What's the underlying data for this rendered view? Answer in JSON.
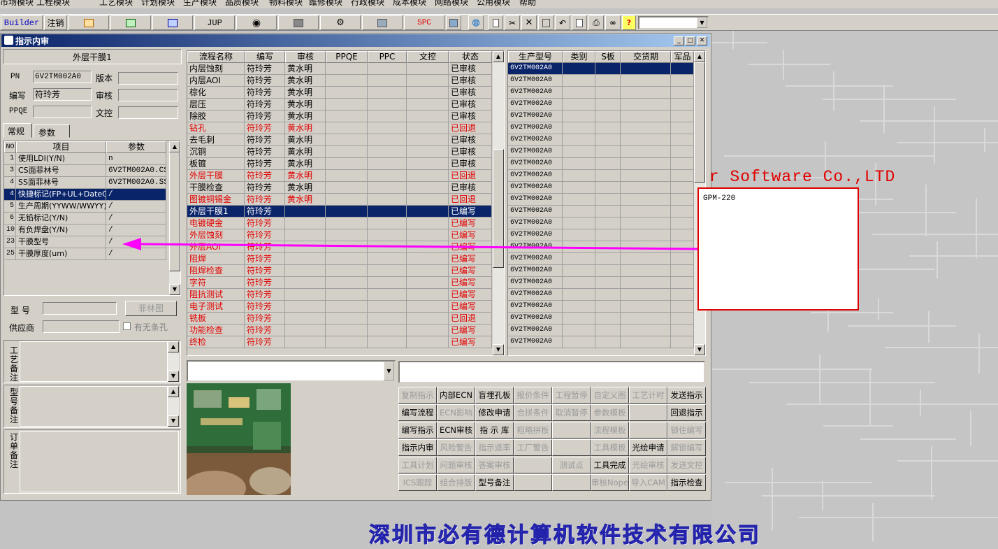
{
  "menu": [
    "市场模块",
    "工程模块",
    "工艺模块",
    "计划模块",
    "生产模块",
    "品质模块",
    "物料模块",
    "维修模块",
    "行政模块",
    "成本模块",
    "网络模块",
    "公用模块",
    "帮助"
  ],
  "toolbar": {
    "builder": "Builder",
    "logout": "注销",
    "jup": "JUP",
    "spc": "SPC",
    "help": "?"
  },
  "window": {
    "title": "指示内审"
  },
  "left": {
    "title": "外层干膜1",
    "pn_label": "PN",
    "pn_value": "6V2TM002A0",
    "version_label": "版本",
    "version_value": "",
    "editor_label": "编写",
    "editor_value": "符玲芳",
    "review_label": "审核",
    "review_value": "",
    "ppqe_label": "PPQE",
    "ppqe_value": "",
    "doc_label": "文控",
    "doc_value": "",
    "tabs": [
      "常规",
      "参数"
    ],
    "param_headers": [
      "NO",
      "项目",
      "参数"
    ],
    "params": [
      {
        "no": "1",
        "item": "使用LDI(Y/N)",
        "value": "n",
        "sel": false
      },
      {
        "no": "3",
        "item": "CS面菲林号",
        "value": "6V2TM002A0.CS2",
        "sel": false
      },
      {
        "no": "4",
        "item": "SS面菲林号",
        "value": "6V2TM002A0.SS2",
        "sel": false
      },
      {
        "no": "4",
        "item": "快捷标记(FP+UL+DateC",
        "value": "/",
        "sel": true
      },
      {
        "no": "5",
        "item": "生产周期(YYWW/WWYY)",
        "value": "/",
        "sel": false
      },
      {
        "no": "6",
        "item": "无铅标记(Y/N)",
        "value": "/",
        "sel": false
      },
      {
        "no": "10",
        "item": "有负焊盘(Y/N)",
        "value": "/",
        "sel": false
      },
      {
        "no": "23",
        "item": "干膜型号",
        "value": "/",
        "sel": false
      },
      {
        "no": "25",
        "item": "干膜厚度(um)",
        "value": "/",
        "sel": false
      }
    ],
    "model_label": "型  号",
    "model_value": "",
    "film_button": "菲林图",
    "supplier_label": "供应商",
    "supplier_value": "",
    "strip_label": "有无条孔",
    "memo_labels": [
      "工艺备注",
      "型号备注",
      "订单备注"
    ]
  },
  "process": {
    "headers": [
      "流程名称",
      "编写",
      "审核",
      "PPQE",
      "PPC",
      "文控",
      "状态"
    ],
    "rows": [
      {
        "name": "内层蚀刻",
        "w": "符玲芳",
        "r": "黄水明",
        "s": "已审核",
        "red": false,
        "sel": false
      },
      {
        "name": "内层AOI",
        "w": "符玲芳",
        "r": "黄水明",
        "s": "已审核",
        "red": false,
        "sel": false
      },
      {
        "name": "棕化",
        "w": "符玲芳",
        "r": "黄水明",
        "s": "已审核",
        "red": false,
        "sel": false
      },
      {
        "name": "层压",
        "w": "符玲芳",
        "r": "黄水明",
        "s": "已审核",
        "red": false,
        "sel": false
      },
      {
        "name": "除胶",
        "w": "符玲芳",
        "r": "黄水明",
        "s": "已审核",
        "red": false,
        "sel": false
      },
      {
        "name": "钻孔",
        "w": "符玲芳",
        "r": "黄水明",
        "s": "已回退",
        "red": true,
        "sel": false
      },
      {
        "name": "去毛刺",
        "w": "符玲芳",
        "r": "黄水明",
        "s": "已审核",
        "red": false,
        "sel": false
      },
      {
        "name": "沉铜",
        "w": "符玲芳",
        "r": "黄水明",
        "s": "已审核",
        "red": false,
        "sel": false
      },
      {
        "name": "板镀",
        "w": "符玲芳",
        "r": "黄水明",
        "s": "已审核",
        "red": false,
        "sel": false
      },
      {
        "name": "外层干膜",
        "w": "符玲芳",
        "r": "黄水明",
        "s": "已回退",
        "red": true,
        "sel": false
      },
      {
        "name": "干膜检查",
        "w": "符玲芳",
        "r": "黄水明",
        "s": "已审核",
        "red": false,
        "sel": false
      },
      {
        "name": "图镀铜锡金",
        "w": "符玲芳",
        "r": "黄水明",
        "s": "已回退",
        "red": true,
        "sel": false
      },
      {
        "name": "外层干膜1",
        "w": "符玲芳",
        "r": "",
        "s": "已编写",
        "red": true,
        "sel": true
      },
      {
        "name": "电镀硬金",
        "w": "符玲芳",
        "r": "",
        "s": "已编写",
        "red": true,
        "sel": false
      },
      {
        "name": "外层蚀刻",
        "w": "符玲芳",
        "r": "",
        "s": "已编写",
        "red": true,
        "sel": false
      },
      {
        "name": "外层AOI",
        "w": "符玲芳",
        "r": "",
        "s": "已编写",
        "red": true,
        "sel": false
      },
      {
        "name": "阻焊",
        "w": "符玲芳",
        "r": "",
        "s": "已编写",
        "red": true,
        "sel": false
      },
      {
        "name": "阻焊检查",
        "w": "符玲芳",
        "r": "",
        "s": "已编写",
        "red": true,
        "sel": false
      },
      {
        "name": "字符",
        "w": "符玲芳",
        "r": "",
        "s": "已编写",
        "red": true,
        "sel": false
      },
      {
        "name": "阻抗测试",
        "w": "符玲芳",
        "r": "",
        "s": "已编写",
        "red": true,
        "sel": false
      },
      {
        "name": "电子测试",
        "w": "符玲芳",
        "r": "",
        "s": "已编写",
        "red": true,
        "sel": false
      },
      {
        "name": "铣板",
        "w": "符玲芳",
        "r": "",
        "s": "已回退",
        "red": true,
        "sel": false
      },
      {
        "name": "功能检查",
        "w": "符玲芳",
        "r": "",
        "s": "已编写",
        "red": true,
        "sel": false
      },
      {
        "name": "终检",
        "w": "符玲芳",
        "r": "",
        "s": "已编写",
        "red": true,
        "sel": false
      }
    ]
  },
  "models": {
    "headers": [
      "生产型号",
      "类别",
      "S板",
      "交货期",
      "军品"
    ],
    "rows": [
      "6V2TM002A0",
      "6V2TM002A0",
      "6V2TM002A0",
      "6V2TM002A0",
      "6V2TM002A0",
      "6V2TM002A0",
      "6V2TM002A0",
      "6V2TM002A0",
      "6V2TM002A0",
      "6V2TM002A0",
      "6V2TM002A0",
      "6V2TM002A0",
      "6V2TM002A0",
      "6V2TM002A0",
      "6V2TM002A0",
      "6V2TM002A0",
      "6V2TM002A0",
      "6V2TM002A0",
      "6V2TM002A0",
      "6V2TM002A0",
      "6V2TM002A0",
      "6V2TM002A0",
      "6V2TM002A0",
      "6V2TM002A0"
    ]
  },
  "buttons": [
    [
      "复制指示",
      "内部ECN",
      "盲埋孔板",
      "报价条件",
      "工程暂停",
      "自定义图",
      "工艺计时",
      "发送指示"
    ],
    [
      "编写流程",
      "ECN影响",
      "修改申请",
      "合拼条件",
      "取消暂停",
      "参数模板",
      "",
      "回退指示"
    ],
    [
      "编写指示",
      "ECN审核",
      "指 示 库",
      "粗略拼板",
      "",
      "流程模板",
      "",
      "锁住编写"
    ],
    [
      "指示内审",
      "风险警告",
      "指示退率",
      "工厂警告",
      "",
      "工具模板",
      "光绘申请",
      "解锁编写"
    ],
    [
      "工具计划",
      "问题审核",
      "答案审核",
      "",
      "测试点",
      "工具完成",
      "光绘审核",
      "发送文控"
    ],
    [
      "ICS跟踪",
      "组合排版",
      "型号备注",
      "",
      "",
      "审核Nope",
      "导入CAM",
      "指示检查"
    ]
  ],
  "buttons_enabled": [
    [
      false,
      true,
      true,
      false,
      false,
      false,
      false,
      true
    ],
    [
      true,
      false,
      true,
      false,
      false,
      false,
      false,
      true
    ],
    [
      true,
      true,
      true,
      false,
      false,
      false,
      false,
      false
    ],
    [
      true,
      false,
      false,
      false,
      false,
      false,
      true,
      false
    ],
    [
      false,
      false,
      false,
      false,
      false,
      true,
      false,
      false
    ],
    [
      false,
      false,
      true,
      false,
      false,
      false,
      false,
      true
    ]
  ],
  "popup_text": "GPM-220",
  "brand_text": "er Software Co.,LTD",
  "company_text": "深圳市必有德计算机软件技术有限公司",
  "colors": {
    "title_blue": "#0a246a",
    "status_red": "#e00000",
    "arrow": "#ff00ff",
    "company": "#4444cc"
  }
}
